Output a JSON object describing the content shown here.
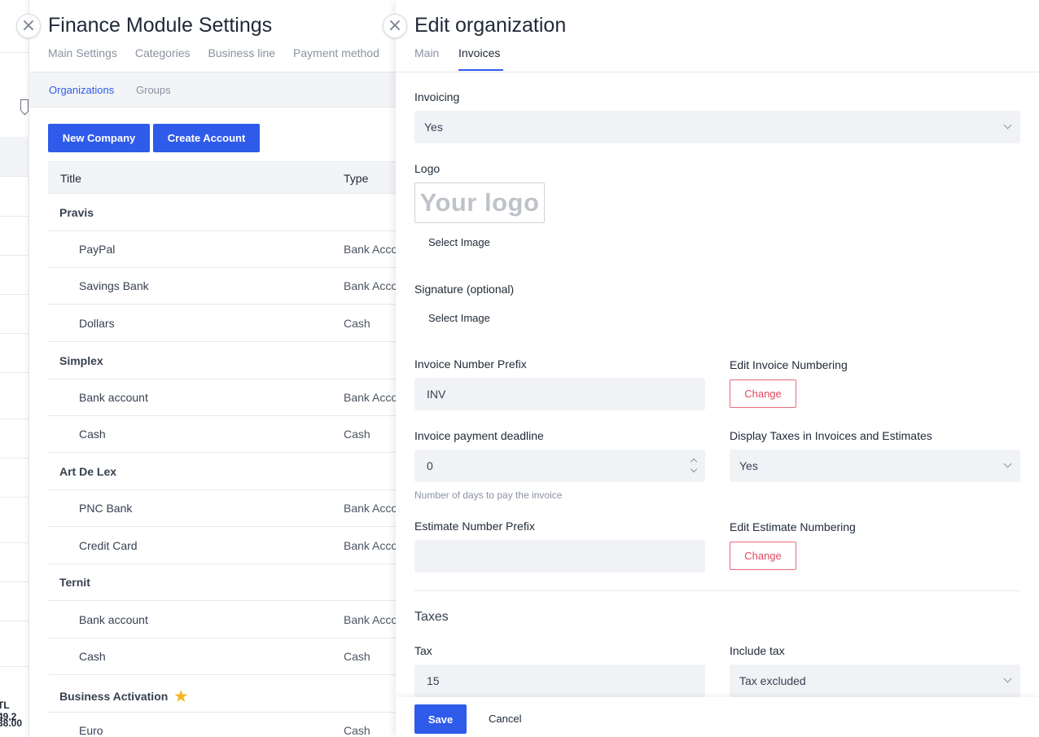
{
  "background": {
    "partial_texts": [
      "TL 49,2",
      "38.00"
    ]
  },
  "finance_panel": {
    "title": "Finance Module Settings",
    "tabs": [
      "Main Settings",
      "Categories",
      "Business line",
      "Payment method"
    ],
    "subtabs": {
      "active": "Organizations",
      "other": "Groups"
    },
    "buttons": {
      "new_company": "New Company",
      "create_account": "Create Account"
    },
    "table": {
      "columns": [
        "Title",
        "Type"
      ],
      "rows": [
        {
          "title": "Pravis",
          "type": ""
        },
        {
          "title": "PayPal",
          "type": "Bank Account"
        },
        {
          "title": "Savings Bank",
          "type": "Bank Account"
        },
        {
          "title": "Dollars",
          "type": "Cash"
        },
        {
          "title": "Simplex",
          "type": ""
        },
        {
          "title": "Bank account",
          "type": "Bank Account"
        },
        {
          "title": "Cash",
          "type": "Cash"
        },
        {
          "title": "Art De Lex",
          "type": ""
        },
        {
          "title": "PNC Bank",
          "type": "Bank Account"
        },
        {
          "title": "Credit Card",
          "type": "Bank Account"
        },
        {
          "title": "Ternit",
          "type": ""
        },
        {
          "title": "Bank account",
          "type": "Bank Account"
        },
        {
          "title": "Cash",
          "type": "Cash"
        },
        {
          "title": "Business Activation",
          "type": "",
          "starred": true
        },
        {
          "title": "Euro",
          "type": "Cash"
        }
      ]
    },
    "colors": {
      "accent": "#2f5bea",
      "star": "#f5b521"
    }
  },
  "edit_panel": {
    "title": "Edit organization",
    "tabs": {
      "main": "Main",
      "invoices": "Invoices",
      "active": "Invoices"
    },
    "invoicing": {
      "label": "Invoicing",
      "value": "Yes"
    },
    "logo": {
      "label": "Logo",
      "placeholder_text": "Your logo",
      "select": "Select Image"
    },
    "signature": {
      "label": "Signature (optional)",
      "select": "Select Image"
    },
    "invoice_prefix": {
      "label": "Invoice Number Prefix",
      "value": "INV"
    },
    "invoice_numbering": {
      "label": "Edit Invoice Numbering",
      "button": "Change"
    },
    "payment_deadline": {
      "label": "Invoice payment deadline",
      "value": "0",
      "hint": "Number of days to pay the invoice"
    },
    "display_taxes": {
      "label": "Display Taxes in Invoices and Estimates",
      "value": "Yes"
    },
    "estimate_prefix": {
      "label": "Estimate Number Prefix",
      "value": ""
    },
    "estimate_numbering": {
      "label": "Edit Estimate Numbering",
      "button": "Change"
    },
    "taxes": {
      "section_title": "Taxes",
      "tax": {
        "label": "Tax",
        "value": "15"
      },
      "include_tax": {
        "label": "Include tax",
        "value": "Tax excluded"
      }
    },
    "footer": {
      "save": "Save",
      "cancel": "Cancel"
    },
    "colors": {
      "accent": "#2f5bea",
      "danger": "#e0485f"
    }
  }
}
